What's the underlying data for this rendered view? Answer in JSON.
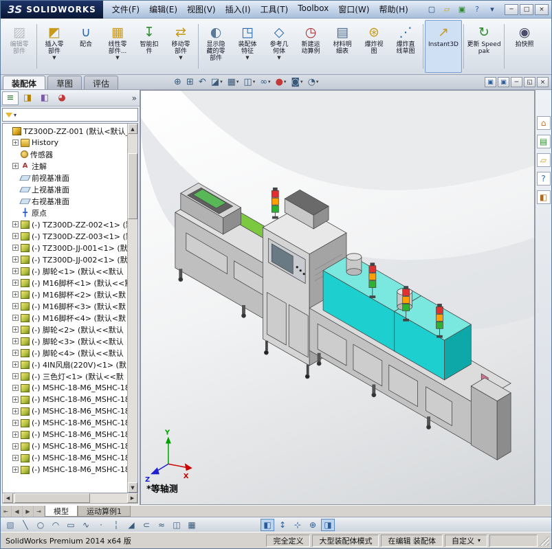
{
  "titlebar": {
    "logo_mark": "3S",
    "logo_text": "SOLIDWORKS",
    "menus": [
      {
        "name": "menu-file",
        "label": "文件(F)"
      },
      {
        "name": "menu-edit",
        "label": "编辑(E)"
      },
      {
        "name": "menu-view",
        "label": "视图(V)"
      },
      {
        "name": "menu-insert",
        "label": "插入(I)"
      },
      {
        "name": "menu-tools",
        "label": "工具(T)"
      },
      {
        "name": "menu-toolbox",
        "label": "Toolbox"
      },
      {
        "name": "menu-window",
        "label": "窗口(W)"
      },
      {
        "name": "menu-help",
        "label": "帮助(H)"
      }
    ],
    "quick_icons": [
      {
        "name": "new-document-icon",
        "glyph": "▢",
        "color": "#2a4a7a"
      },
      {
        "name": "open-document-icon",
        "glyph": "▱",
        "color": "#c8a020"
      },
      {
        "name": "save-document-icon",
        "glyph": "▣",
        "color": "#2e8b2e"
      },
      {
        "name": "help-icon",
        "glyph": "?",
        "color": "#2a6ab0"
      },
      {
        "name": "expand-menu-icon",
        "glyph": "▾",
        "color": "#2a4a7a"
      }
    ],
    "window_buttons": [
      {
        "name": "minimize-button",
        "glyph": "─"
      },
      {
        "name": "maximize-button",
        "glyph": "□"
      },
      {
        "name": "close-button",
        "glyph": "×"
      }
    ]
  },
  "ribbon": {
    "buttons": [
      {
        "name": "ribbon-edit-component",
        "label": "编辑零部件",
        "glyph": "▨",
        "color": "#7a7a7a",
        "disabled": true
      },
      {
        "sep": true
      },
      {
        "name": "ribbon-insert-component",
        "label": "插入零部件",
        "glyph": "◩",
        "color": "#c89a1a",
        "arrow": "▼"
      },
      {
        "name": "ribbon-mate",
        "label": "配合",
        "glyph": "∪",
        "color": "#2a6ab0"
      },
      {
        "name": "ribbon-linear-component-pattern",
        "label": "线性零部件...",
        "glyph": "▦",
        "color": "#c89a1a",
        "arrow": "▼"
      },
      {
        "name": "ribbon-smart-fasteners",
        "label": "智能扣件",
        "glyph": "↧",
        "color": "#2e8b2e"
      },
      {
        "name": "ribbon-move-component",
        "label": "移动零部件",
        "glyph": "⇄",
        "color": "#c89a1a",
        "arrow": "▼"
      },
      {
        "sep": true
      },
      {
        "name": "ribbon-show-hidden-components",
        "label": "显示隐藏的零部件",
        "glyph": "◐",
        "color": "#5a7a9a"
      },
      {
        "name": "ribbon-assembly-features",
        "label": "装配体特征",
        "glyph": "◳",
        "color": "#2a6ab0",
        "arrow": "▼"
      },
      {
        "name": "ribbon-reference-geometry",
        "label": "参考几何体",
        "glyph": "◇",
        "color": "#2a6ab0",
        "arrow": "▼"
      },
      {
        "name": "ribbon-new-motion-study",
        "label": "新建运动算例",
        "glyph": "◷",
        "color": "#b03030"
      },
      {
        "name": "ribbon-bill-of-materials",
        "label": "材料明细表",
        "glyph": "▤",
        "color": "#4a6a8a"
      },
      {
        "name": "ribbon-exploded-view",
        "label": "爆炸视图",
        "glyph": "⊛",
        "color": "#c89a1a"
      },
      {
        "name": "ribbon-explode-line-sketch",
        "label": "爆炸直线草图",
        "glyph": "⋰",
        "color": "#2a6ab0"
      },
      {
        "sep": true
      },
      {
        "name": "ribbon-instant3d",
        "label": "Instant3D",
        "glyph": "↗",
        "color": "#c89a1a",
        "active": true,
        "wide": true
      },
      {
        "sep": true
      },
      {
        "name": "ribbon-update-speedpak",
        "label": "更新 Speedpak",
        "glyph": "↻",
        "color": "#2e8b2e",
        "wide": true
      },
      {
        "sep": true
      },
      {
        "name": "ribbon-take-snapshot",
        "label": "拍快照",
        "glyph": "◉",
        "color": "#4a4a6a",
        "wide": true
      }
    ]
  },
  "command_tabs": {
    "items": [
      {
        "name": "tab-assembly",
        "label": "装配体",
        "active": true
      },
      {
        "name": "tab-sketch",
        "label": "草图"
      },
      {
        "name": "tab-evaluate",
        "label": "评估"
      }
    ]
  },
  "hud": {
    "items": [
      {
        "name": "zoom-to-fit-icon",
        "glyph": "⊕",
        "color": "#3a5a7a"
      },
      {
        "name": "zoom-to-area-icon",
        "glyph": "⊞",
        "color": "#3a5a7a"
      },
      {
        "name": "previous-view-icon",
        "glyph": "↶",
        "color": "#3a5a7a"
      },
      {
        "name": "section-view-icon",
        "glyph": "◪",
        "color": "#3a5a7a",
        "arrow": "▾"
      },
      {
        "name": "view-orientation-icon",
        "glyph": "▦",
        "color": "#3a5a7a",
        "arrow": "▾"
      },
      {
        "name": "display-style-icon",
        "glyph": "◫",
        "color": "#3a5a7a",
        "arrow": "▾"
      },
      {
        "name": "hide-show-items-icon",
        "glyph": "∞",
        "color": "#3a5a7a",
        "arrow": "▾"
      },
      {
        "name": "edit-appearance-icon",
        "glyph": "●",
        "color": "#c03a3a",
        "arrow": "▾"
      },
      {
        "name": "apply-scene-icon",
        "glyph": "◙",
        "color": "#3a5a7a",
        "arrow": "▾"
      },
      {
        "name": "view-settings-icon",
        "glyph": "◔",
        "color": "#3a5a7a",
        "arrow": "▾"
      }
    ]
  },
  "child_window": {
    "buttons": [
      {
        "name": "split-view-icon",
        "glyph": "▣",
        "color": "#2a5a9a"
      },
      {
        "name": "full-view-icon",
        "glyph": "▣",
        "color": "#2a5a9a"
      },
      {
        "name": "child-minimize-button",
        "glyph": "─"
      },
      {
        "name": "child-restore-button",
        "glyph": "◱"
      },
      {
        "name": "child-close-button",
        "glyph": "×"
      }
    ]
  },
  "panel": {
    "tabs": [
      {
        "name": "featuremanager-tab",
        "glyph": "≡",
        "color": "#2e7d32",
        "active": true
      },
      {
        "name": "propertymanager-tab",
        "glyph": "◨",
        "color": "#b08000"
      },
      {
        "name": "configurationmanager-tab",
        "glyph": "◧",
        "color": "#7a5aaa"
      },
      {
        "name": "displaymanager-tab",
        "glyph": "◕",
        "color": "#c03a3a"
      }
    ],
    "chevron": "»",
    "filter_caret": "▾",
    "filter_placeholder": ""
  },
  "tree": {
    "items": [
      {
        "cls": "lvl0",
        "exp": "",
        "ic": "ic-asm",
        "g": "",
        "label": "TZ300D-ZZ-001 (默认<默认_"
      },
      {
        "cls": "lvl1",
        "exp": "+",
        "ic": "ic-hist",
        "g": "",
        "label": "History"
      },
      {
        "cls": "lvl1",
        "exp": "",
        "ic": "ic-sensor",
        "g": "",
        "label": "传感器"
      },
      {
        "cls": "lvl1",
        "exp": "+",
        "ic": "ic-note",
        "g": "A",
        "label": "注解"
      },
      {
        "cls": "lvl1",
        "exp": "",
        "ic": "ic-plane",
        "g": "",
        "label": "前视基准面"
      },
      {
        "cls": "lvl1",
        "exp": "",
        "ic": "ic-plane",
        "g": "",
        "label": "上视基准面"
      },
      {
        "cls": "lvl1",
        "exp": "",
        "ic": "ic-plane",
        "g": "",
        "label": "右视基准面"
      },
      {
        "cls": "lvl1",
        "exp": "",
        "ic": "ic-origin",
        "g": "╋",
        "label": "原点"
      },
      {
        "cls": "lvl1",
        "exp": "+",
        "ic": "ic-part",
        "g": "",
        "label": "(-) TZ300D-ZZ-002<1> (默"
      },
      {
        "cls": "lvl1",
        "exp": "+",
        "ic": "ic-part",
        "g": "",
        "label": "(-) TZ300D-ZZ-003<1> (默"
      },
      {
        "cls": "lvl1",
        "exp": "+",
        "ic": "ic-part",
        "g": "",
        "label": "(-) TZ300D-JJ-001<1> (默"
      },
      {
        "cls": "lvl1",
        "exp": "+",
        "ic": "ic-part",
        "g": "",
        "label": "(-) TZ300D-JJ-002<1> (默"
      },
      {
        "cls": "lvl1",
        "exp": "+",
        "ic": "ic-part",
        "g": "",
        "label": "(-) 脚轮<1> (默认<<默认"
      },
      {
        "cls": "lvl1",
        "exp": "+",
        "ic": "ic-part",
        "g": "",
        "label": "(-) M16脚杯<1> (默认<<默"
      },
      {
        "cls": "lvl1",
        "exp": "+",
        "ic": "ic-part",
        "g": "",
        "label": "(-) M16脚杯<2> (默认<默"
      },
      {
        "cls": "lvl1",
        "exp": "+",
        "ic": "ic-part",
        "g": "",
        "label": "(-) M16脚杯<3> (默认<默"
      },
      {
        "cls": "lvl1",
        "exp": "+",
        "ic": "ic-part",
        "g": "",
        "label": "(-) M16脚杯<4> (默认<默"
      },
      {
        "cls": "lvl1",
        "exp": "+",
        "ic": "ic-part",
        "g": "",
        "label": "(-) 脚轮<2> (默认<<默认"
      },
      {
        "cls": "lvl1",
        "exp": "+",
        "ic": "ic-part",
        "g": "",
        "label": "(-) 脚轮<3> (默认<<默认"
      },
      {
        "cls": "lvl1",
        "exp": "+",
        "ic": "ic-part",
        "g": "",
        "label": "(-) 脚轮<4> (默认<<默认"
      },
      {
        "cls": "lvl1",
        "exp": "+",
        "ic": "ic-part",
        "g": "",
        "label": "(-) 4IN风扇(220V)<1> (默"
      },
      {
        "cls": "lvl1",
        "exp": "+",
        "ic": "ic-part",
        "g": "",
        "label": "(-) 三色灯<1> (默认<<默"
      },
      {
        "cls": "lvl1",
        "exp": "+",
        "ic": "ic-part",
        "g": "",
        "label": "(-) MSHC-18-M6_MSHC-18-"
      },
      {
        "cls": "lvl1",
        "exp": "+",
        "ic": "ic-part",
        "g": "",
        "label": "(-) MSHC-18-M6_MSHC-18-"
      },
      {
        "cls": "lvl1",
        "exp": "+",
        "ic": "ic-part",
        "g": "",
        "label": "(-) MSHC-18-M6_MSHC-18-"
      },
      {
        "cls": "lvl1",
        "exp": "+",
        "ic": "ic-part",
        "g": "",
        "label": "(-) MSHC-18-M6_MSHC-18-"
      },
      {
        "cls": "lvl1",
        "exp": "+",
        "ic": "ic-part",
        "g": "",
        "label": "(-) MSHC-18-M6_MSHC-18-"
      },
      {
        "cls": "lvl1",
        "exp": "+",
        "ic": "ic-part",
        "g": "",
        "label": "(-) MSHC-18-M6_MSHC-18-"
      },
      {
        "cls": "lvl1",
        "exp": "+",
        "ic": "ic-part",
        "g": "",
        "label": "(-) MSHC-18-M6_MSHC-18-"
      },
      {
        "cls": "lvl1",
        "exp": "+",
        "ic": "ic-part",
        "g": "",
        "label": "(-) MSHC-18-M6_MSHC-18-"
      }
    ]
  },
  "scrollbars": {
    "up": "▲",
    "down": "▼",
    "left": "◀",
    "right": "▶"
  },
  "viewport": {
    "view_label": "*等轴测",
    "triad": {
      "x": "X",
      "y": "Y",
      "z": "Z"
    },
    "colors": {
      "highlight_cyan": "#1ecfcf",
      "machine_gray": "#c2c2c2",
      "belt_green": "#7cc840"
    }
  },
  "task_pane": {
    "items": [
      {
        "name": "resources-home-icon",
        "glyph": "⌂",
        "color": "#c87828"
      },
      {
        "name": "design-library-icon",
        "glyph": "▤",
        "color": "#2e8b2e"
      },
      {
        "name": "file-explorer-icon",
        "glyph": "▱",
        "color": "#c8a020"
      },
      {
        "name": "forum-help-icon",
        "glyph": "?",
        "color": "#2a6ab0"
      },
      {
        "name": "appearances-icon",
        "glyph": "◧",
        "color": "#b06a20"
      }
    ]
  },
  "model_tabs": {
    "nav": [
      {
        "name": "first-tab-button",
        "glyph": "⇤"
      },
      {
        "name": "prev-tab-button",
        "glyph": "◀"
      },
      {
        "name": "next-tab-button",
        "glyph": "▶"
      },
      {
        "name": "last-tab-button",
        "glyph": "⇥"
      }
    ],
    "tabs": [
      {
        "name": "model-tab",
        "label": "模型",
        "active": true
      },
      {
        "name": "motion-study-tab",
        "label": "运动算例1"
      }
    ]
  },
  "bottom_toolbar": {
    "items": [
      {
        "name": "sketch-icon",
        "glyph": "▧",
        "color": "#5a7a9a"
      },
      {
        "name": "line-icon",
        "glyph": "╲",
        "color": "#3a5a7a"
      },
      {
        "name": "circle-icon",
        "glyph": "○",
        "color": "#3a5a7a"
      },
      {
        "name": "arc-icon",
        "glyph": "◠",
        "color": "#3a5a7a"
      },
      {
        "name": "rectangle-icon",
        "glyph": "▭",
        "color": "#3a5a7a"
      },
      {
        "name": "spline-icon",
        "glyph": "∿",
        "color": "#3a5a7a"
      },
      {
        "name": "point-icon",
        "glyph": "·",
        "color": "#3a5a7a"
      },
      {
        "name": "centerline-icon",
        "glyph": "╎",
        "color": "#3a5a7a"
      },
      {
        "name": "trim-entities-icon",
        "glyph": "◢",
        "color": "#3a5a7a"
      },
      {
        "name": "convert-entities-icon",
        "glyph": "⊂",
        "color": "#3a5a7a"
      },
      {
        "name": "offset-entities-icon",
        "glyph": "≈",
        "color": "#3a5a7a"
      },
      {
        "name": "mirror-entities-icon",
        "glyph": "◫",
        "color": "#3a5a7a"
      },
      {
        "name": "linear-sketch-pattern-icon",
        "glyph": "▦",
        "color": "#3a5a7a"
      },
      {
        "spacer": true
      },
      {
        "name": "view-orientation-cube-icon",
        "glyph": "◧",
        "color": "#2a5a9a",
        "active": true
      },
      {
        "name": "rotate-view-icon",
        "glyph": "↕",
        "color": "#2a5a9a"
      },
      {
        "name": "pan-view-icon",
        "glyph": "⊹",
        "color": "#2a5a9a"
      },
      {
        "name": "zoom-view-icon",
        "glyph": "⊕",
        "color": "#2a5a9a"
      },
      {
        "name": "normal-to-icon",
        "glyph": "◨",
        "color": "#2a5a9a",
        "active": true
      }
    ]
  },
  "status": {
    "app": "SolidWorks Premium 2014 x64 版",
    "cells": [
      "完全定义",
      "大型装配体模式",
      "在编辑 装配体"
    ],
    "custom": "自定义",
    "custom_caret": "▾"
  }
}
